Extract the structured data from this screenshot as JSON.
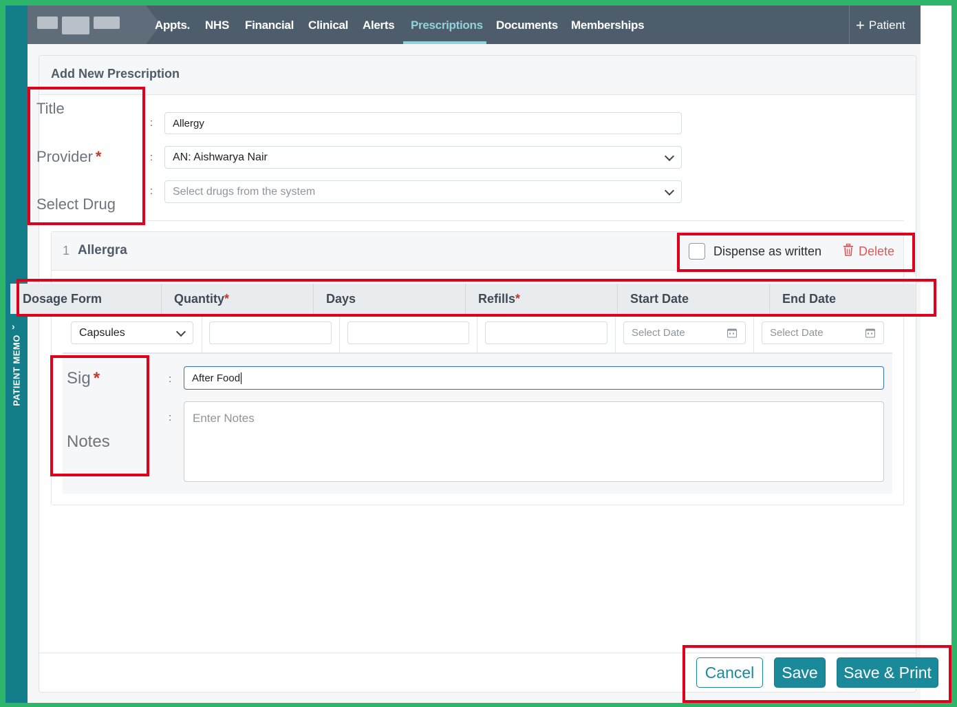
{
  "memo_bar": {
    "label": "PATIENT MEMO",
    "chevron": "›"
  },
  "nav": {
    "items": [
      "Appts.",
      "NHS",
      "Financial",
      "Clinical",
      "Alerts",
      "Prescriptions",
      "Documents",
      "Memberships"
    ],
    "active": "Prescriptions",
    "patient_button": "Patient",
    "plus": "+"
  },
  "card": {
    "title": "Add New Prescription"
  },
  "form": {
    "title_label": "Title",
    "provider_label": "Provider",
    "drug_label": "Select Drug",
    "required_mark": "*",
    "colon": ":",
    "title_value": "Allergy",
    "provider_value": "AN: Aishwarya Nair",
    "drug_placeholder": "Select drugs from the system"
  },
  "drug": {
    "index": "1",
    "name": "Allergra",
    "dispense_label": "Dispense as written",
    "dispense_checked": false,
    "delete_label": "Delete"
  },
  "columns": {
    "dosage": "Dosage Form",
    "quantity": "Quantity",
    "days": "Days",
    "refills": "Refills",
    "start": "Start Date",
    "end": "End Date"
  },
  "row": {
    "dosage_value": "Capsules",
    "quantity_value": "",
    "days_value": "",
    "refills_value": "",
    "start_placeholder": "Select Date",
    "end_placeholder": "Select Date"
  },
  "sig": {
    "sig_label": "Sig",
    "notes_label": "Notes",
    "sig_value": "After Food",
    "notes_placeholder": "Enter Notes"
  },
  "buttons": {
    "cancel": "Cancel",
    "save": "Save",
    "save_print": "Save & Print"
  },
  "colors": {
    "accent": "#1a8a9a",
    "nav_bg": "#4e5d6c",
    "memo_bg": "#137d8a",
    "annotation": "#e0001b",
    "required": "#c0392b"
  }
}
